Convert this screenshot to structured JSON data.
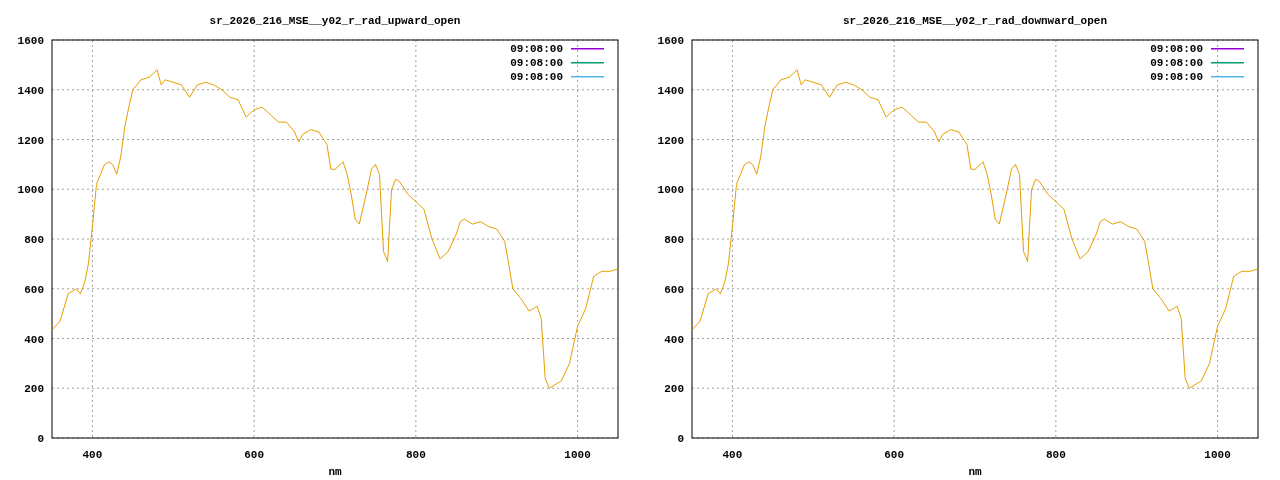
{
  "charts": [
    {
      "legend": [
        {
          "label": "09:08:00",
          "color": "#9400d3"
        },
        {
          "label": "09:08:00",
          "color": "#009e73"
        },
        {
          "label": "09:08:00",
          "color": "#56b4e9"
        }
      ],
      "chart_data": {
        "type": "line",
        "grid": true,
        "title": "sr_2026_216_MSE__y02_r_rad_upward_open",
        "xlabel": "nm",
        "xlim": [
          350,
          1050
        ],
        "ylim": [
          0,
          1600
        ],
        "xticks": [
          400,
          600,
          800,
          1000
        ],
        "yticks": [
          0,
          200,
          400,
          600,
          800,
          1000,
          1200,
          1400,
          1600
        ],
        "x": [
          350,
          360,
          370,
          380,
          385,
          390,
          395,
          400,
          405,
          410,
          415,
          420,
          425,
          430,
          435,
          440,
          445,
          450,
          460,
          470,
          480,
          485,
          490,
          500,
          510,
          520,
          530,
          540,
          550,
          560,
          570,
          580,
          590,
          600,
          610,
          620,
          630,
          640,
          650,
          655,
          660,
          670,
          680,
          690,
          695,
          700,
          710,
          715,
          720,
          725,
          730,
          740,
          745,
          750,
          755,
          760,
          765,
          770,
          775,
          780,
          790,
          800,
          810,
          820,
          830,
          840,
          850,
          855,
          860,
          870,
          880,
          890,
          900,
          910,
          920,
          930,
          940,
          950,
          955,
          960,
          965,
          970,
          980,
          990,
          1000,
          1010,
          1020,
          1030,
          1040,
          1050
        ],
        "series": [
          {
            "color": "#e69f00",
            "values": [
              435,
              470,
              580,
              600,
              580,
              620,
              700,
              850,
              1020,
              1060,
              1100,
              1110,
              1100,
              1060,
              1130,
              1250,
              1330,
              1400,
              1440,
              1450,
              1480,
              1420,
              1440,
              1430,
              1420,
              1370,
              1420,
              1430,
              1420,
              1400,
              1370,
              1360,
              1290,
              1320,
              1330,
              1300,
              1270,
              1270,
              1230,
              1190,
              1220,
              1240,
              1230,
              1180,
              1080,
              1080,
              1110,
              1060,
              980,
              880,
              860,
              1000,
              1080,
              1100,
              1060,
              750,
              710,
              1000,
              1040,
              1030,
              980,
              950,
              920,
              800,
              720,
              750,
              820,
              870,
              880,
              860,
              870,
              850,
              840,
              790,
              600,
              560,
              510,
              530,
              480,
              240,
              200,
              210,
              230,
              300,
              450,
              520,
              650,
              670,
              670,
              680
            ]
          }
        ]
      }
    },
    {
      "legend": [
        {
          "label": "09:08:00",
          "color": "#9400d3"
        },
        {
          "label": "09:08:00",
          "color": "#009e73"
        },
        {
          "label": "09:08:00",
          "color": "#56b4e9"
        }
      ],
      "chart_data": {
        "type": "line",
        "grid": true,
        "title": "sr_2026_216_MSE__y02_r_rad_downward_open",
        "xlabel": "nm",
        "xlim": [
          350,
          1050
        ],
        "ylim": [
          0,
          1600
        ],
        "xticks": [
          400,
          600,
          800,
          1000
        ],
        "yticks": [
          0,
          200,
          400,
          600,
          800,
          1000,
          1200,
          1400,
          1600
        ],
        "x": [
          350,
          360,
          370,
          380,
          385,
          390,
          395,
          400,
          405,
          410,
          415,
          420,
          425,
          430,
          435,
          440,
          445,
          450,
          460,
          470,
          480,
          485,
          490,
          500,
          510,
          520,
          530,
          540,
          550,
          560,
          570,
          580,
          590,
          600,
          610,
          620,
          630,
          640,
          650,
          655,
          660,
          670,
          680,
          690,
          695,
          700,
          710,
          715,
          720,
          725,
          730,
          740,
          745,
          750,
          755,
          760,
          765,
          770,
          775,
          780,
          790,
          800,
          810,
          820,
          830,
          840,
          850,
          855,
          860,
          870,
          880,
          890,
          900,
          910,
          920,
          930,
          940,
          950,
          955,
          960,
          965,
          970,
          980,
          990,
          1000,
          1010,
          1020,
          1030,
          1040,
          1050
        ],
        "series": [
          {
            "color": "#e69f00",
            "values": [
              435,
              470,
              580,
              600,
              580,
              620,
              700,
              850,
              1020,
              1060,
              1100,
              1110,
              1100,
              1060,
              1130,
              1250,
              1330,
              1400,
              1440,
              1450,
              1480,
              1420,
              1440,
              1430,
              1420,
              1370,
              1420,
              1430,
              1420,
              1400,
              1370,
              1360,
              1290,
              1320,
              1330,
              1300,
              1270,
              1270,
              1230,
              1190,
              1220,
              1240,
              1230,
              1180,
              1080,
              1080,
              1110,
              1060,
              980,
              880,
              860,
              1000,
              1080,
              1100,
              1060,
              750,
              710,
              1000,
              1040,
              1030,
              980,
              950,
              920,
              800,
              720,
              750,
              820,
              870,
              880,
              860,
              870,
              850,
              840,
              790,
              600,
              560,
              510,
              530,
              480,
              240,
              200,
              210,
              230,
              300,
              450,
              520,
              650,
              670,
              670,
              680
            ]
          }
        ]
      }
    }
  ]
}
